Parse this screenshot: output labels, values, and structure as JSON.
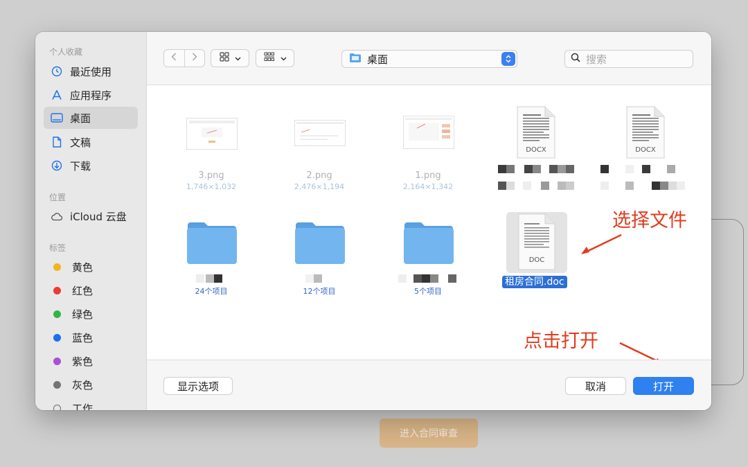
{
  "background": {
    "button_label": "进入合同审查"
  },
  "sidebar": {
    "favorites_header": "个人收藏",
    "favorites": [
      {
        "label": "最近使用",
        "icon": "clock-icon"
      },
      {
        "label": "应用程序",
        "icon": "apps-icon"
      },
      {
        "label": "桌面",
        "icon": "desktop-icon",
        "active": true
      },
      {
        "label": "文稿",
        "icon": "document-icon"
      },
      {
        "label": "下载",
        "icon": "download-icon"
      }
    ],
    "locations_header": "位置",
    "locations": [
      {
        "label": "iCloud 云盘",
        "icon": "cloud-icon"
      }
    ],
    "tags_header": "标签",
    "tags": [
      {
        "label": "黄色",
        "color": "#f2b51c"
      },
      {
        "label": "红色",
        "color": "#ec3a36"
      },
      {
        "label": "绿色",
        "color": "#31b447"
      },
      {
        "label": "蓝色",
        "color": "#1a6ff0"
      },
      {
        "label": "紫色",
        "color": "#a752d6"
      },
      {
        "label": "灰色",
        "color": "#747474"
      },
      {
        "label": "工作",
        "color": ""
      }
    ]
  },
  "toolbar": {
    "path": "桌面",
    "search_placeholder": "搜索"
  },
  "files": [
    {
      "name": "3.png",
      "dims": "1,746×1,032"
    },
    {
      "name": "2.png",
      "dims": "2,476×1,194"
    },
    {
      "name": "1.png",
      "dims": "2,164×1,342"
    },
    {
      "name": "",
      "ext": "DOCX"
    },
    {
      "name": "",
      "ext": "DOCX"
    }
  ],
  "folders": [
    {
      "count": "24个项目"
    },
    {
      "count": "12个项目"
    },
    {
      "count": "5个项目"
    }
  ],
  "selected_file": {
    "name": "租房合同.doc",
    "ext": "DOC"
  },
  "annotations": {
    "select_file": "选择文件",
    "click_open": "点击打开"
  },
  "footer": {
    "options_label": "显示选项",
    "cancel_label": "取消",
    "open_label": "打开"
  },
  "colors": {
    "accent": "#2f80f0",
    "annotation": "#e03c1e",
    "folder": "#6fb3ee"
  }
}
